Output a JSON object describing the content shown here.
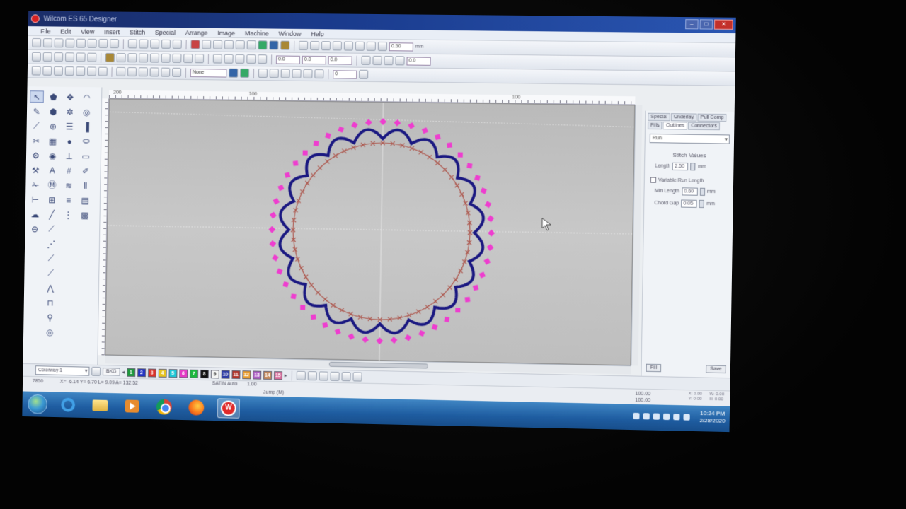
{
  "window": {
    "title": "Wilcom ES 65 Designer"
  },
  "menu": [
    "File",
    "Edit",
    "View",
    "Insert",
    "Stitch",
    "Special",
    "Arrange",
    "Image",
    "Machine",
    "Window",
    "Help"
  ],
  "toolbar": {
    "size_field": "0.50",
    "size_unit": "mm",
    "none_select": "None",
    "rot_field": "0",
    "small_fields": [
      "0.0",
      "0.0",
      "0.0",
      "0.0"
    ]
  },
  "ruler": {
    "h_labels": [
      "200",
      "100",
      "100"
    ]
  },
  "right_panel": {
    "tabs_row1": [
      "Special",
      "Underlay",
      "Pull Comp"
    ],
    "tabs_row2": [
      "Fills",
      "Outlines",
      "Connectors"
    ],
    "active_tab": "Outlines",
    "stitch_type": "Run",
    "group_title": "Stitch Values",
    "length_label": "Length",
    "length_value": "2.50",
    "unit": "mm",
    "variable_label": "Variable Run Length",
    "min_length_label": "Min Length",
    "min_length_value": "0.60",
    "chord_gap_label": "Chord Gap",
    "chord_gap_value": "0.05",
    "bottom_left_btn": "Fill",
    "bottom_right_btn": "Save"
  },
  "colorbar": {
    "colorway": "Colorway 1",
    "bkg_label": "BKG",
    "swatches": [
      {
        "n": "1",
        "color": "#1a9a3a"
      },
      {
        "n": "2",
        "color": "#2232c8"
      },
      {
        "n": "3",
        "color": "#e0332a"
      },
      {
        "n": "4",
        "color": "#e6c21a"
      },
      {
        "n": "5",
        "color": "#18c7d6"
      },
      {
        "n": "6",
        "color": "#e839c8"
      },
      {
        "n": "7",
        "color": "#16b83a"
      },
      {
        "n": "8",
        "color": "#111111"
      },
      {
        "n": "9",
        "color": "#f2f2f2"
      },
      {
        "n": "10",
        "color": "#3240a8"
      },
      {
        "n": "11",
        "color": "#b4342a"
      },
      {
        "n": "12",
        "color": "#e89a2a"
      },
      {
        "n": "13",
        "color": "#b05ec8"
      },
      {
        "n": "14",
        "color": "#c88a5a"
      },
      {
        "n": "15",
        "color": "#d86a9a"
      }
    ]
  },
  "status": {
    "stitch_count": "7850",
    "coords": "X= -6.14 Y= 6.70 L= 9.09 A= 132.52",
    "stitch_type": "SATIN Auto",
    "stitch_value": "1.00",
    "jump": "Jump (M)"
  },
  "status_right": {
    "xa": "X: 0.00",
    "ya": "Y: 0.00",
    "wa": "W: 0.00",
    "ha": "H: 0.00",
    "pw": "100.00",
    "ph": "100.00",
    "unit": "mm"
  },
  "taskbar": {
    "time": "10:24 PM",
    "date": "2/28/2020"
  },
  "design": {
    "colors": {
      "outer_diamonds": "#f23cd2",
      "scallop": "#1c1a86",
      "cross_stitch": "#b0584e",
      "crosshair": "#e2e2e2"
    },
    "outer_diamond_count": 48,
    "scallop_count": 20,
    "cross_count": 56
  }
}
